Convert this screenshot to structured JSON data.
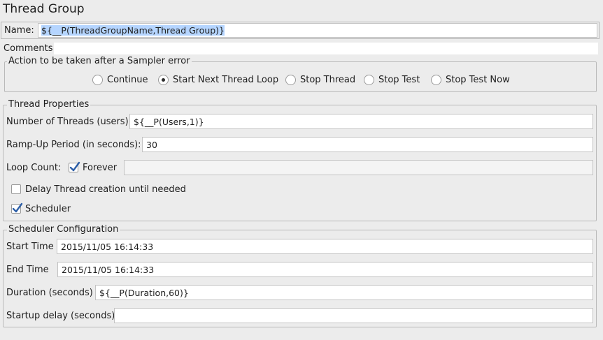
{
  "title": "Thread Group",
  "name_field": {
    "label": "Name:",
    "value": "${__P(ThreadGroupName,Thread Group)}"
  },
  "comments_field": {
    "label": "Comments:",
    "value": ""
  },
  "sampler_error": {
    "legend": "Action to be taken after a Sampler error",
    "options": [
      {
        "label": "Continue",
        "selected": false
      },
      {
        "label": "Start Next Thread Loop",
        "selected": true
      },
      {
        "label": "Stop Thread",
        "selected": false
      },
      {
        "label": "Stop Test",
        "selected": false
      },
      {
        "label": "Stop Test Now",
        "selected": false
      }
    ]
  },
  "thread_properties": {
    "legend": "Thread Properties",
    "num_threads": {
      "label": "Number of Threads (users):",
      "value": "${__P(Users,1)}"
    },
    "ramp_up": {
      "label": "Ramp-Up Period (in seconds):",
      "value": "30"
    },
    "loop_count": {
      "label": "Loop Count:",
      "forever_label": "Forever",
      "forever_checked": true,
      "value": ""
    },
    "delay_creation": {
      "label": "Delay Thread creation until needed",
      "checked": false
    },
    "scheduler": {
      "label": "Scheduler",
      "checked": true
    }
  },
  "scheduler_config": {
    "legend": "Scheduler Configuration",
    "start_time": {
      "label": "Start Time",
      "value": "2015/11/05 16:14:33"
    },
    "end_time": {
      "label": "End Time",
      "value": "2015/11/05 16:14:33"
    },
    "duration": {
      "label": "Duration (seconds)",
      "value": "${__P(Duration,60)}"
    },
    "startup_delay": {
      "label": "Startup delay (seconds)",
      "value": ""
    }
  },
  "colors": {
    "background": "#ececec",
    "border": "#b9b9b9",
    "selection": "#b5d5ff",
    "checkmark": "#2d5fa8"
  }
}
